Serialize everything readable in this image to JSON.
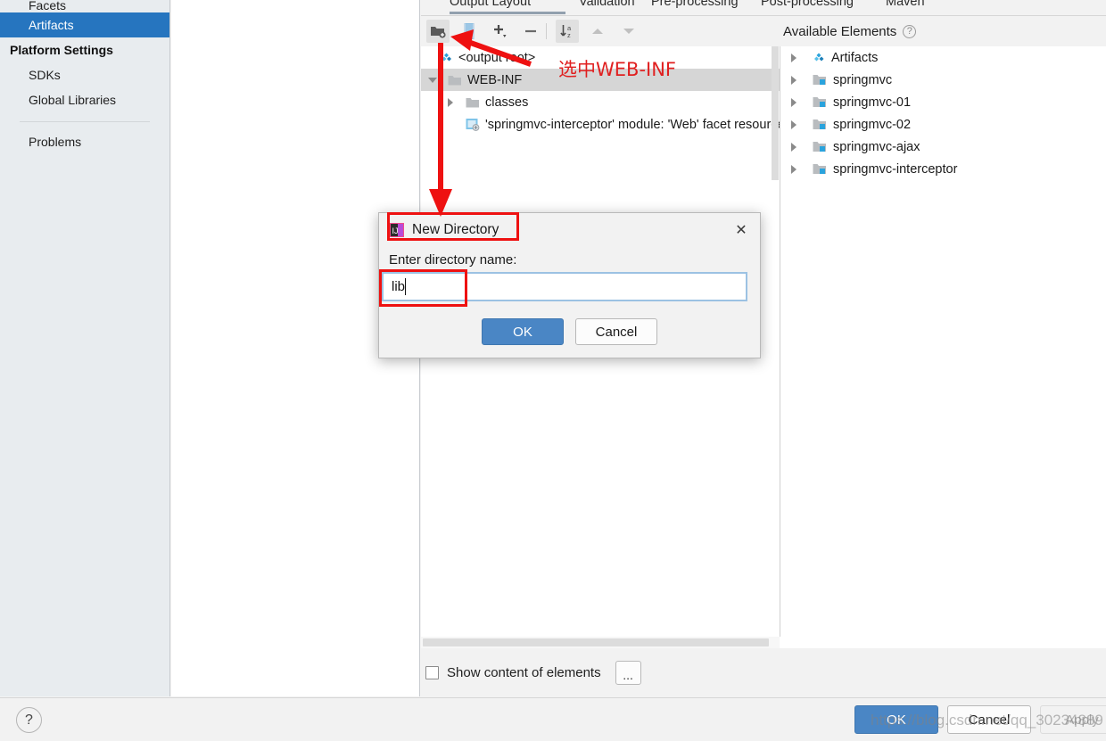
{
  "sidebar": {
    "items": [
      {
        "label": "Facets",
        "type": "item",
        "state": "clipped"
      },
      {
        "label": "Artifacts",
        "type": "item",
        "state": "selected"
      },
      {
        "label": "Platform Settings",
        "type": "group"
      },
      {
        "label": "SDKs",
        "type": "item"
      },
      {
        "label": "Global Libraries",
        "type": "item"
      },
      {
        "label": "Problems",
        "type": "item"
      }
    ]
  },
  "main": {
    "tabs": [
      {
        "label": "Output Layout",
        "selected": true
      },
      {
        "label": "Validation",
        "selected": false
      },
      {
        "label": "Pre-processing",
        "selected": false
      },
      {
        "label": "Post-processing",
        "selected": false
      },
      {
        "label": "Maven",
        "selected": false
      }
    ],
    "toolbar": {
      "buttons": [
        {
          "name": "create-directory-button",
          "icon": "folder-plus-icon",
          "active": true
        },
        {
          "name": "create-archive-button",
          "icon": "archive-icon",
          "active": false
        },
        {
          "name": "add-button",
          "icon": "plus-icon",
          "active": false
        },
        {
          "name": "remove-button",
          "icon": "minus-icon",
          "active": false
        },
        {
          "name": "sort-button",
          "icon": "sort-az-icon",
          "active": true
        },
        {
          "name": "move-up-button",
          "icon": "chevron-up-icon",
          "active": false
        },
        {
          "name": "move-down-button",
          "icon": "chevron-down-icon",
          "active": false
        }
      ]
    },
    "output_tree": [
      {
        "label": "<output root>",
        "icon": "artifact-diamond-icon",
        "indent": 0,
        "twisty": "open-diamond",
        "selected": false
      },
      {
        "label": "WEB-INF",
        "icon": "folder-icon",
        "indent": 1,
        "twisty": "open",
        "selected": true
      },
      {
        "label": "classes",
        "icon": "folder-icon",
        "indent": 2,
        "twisty": "closed",
        "selected": false
      },
      {
        "label": "'springmvc-interceptor' module: 'Web' facet resources",
        "icon": "facet-resource-icon",
        "indent": 2,
        "twisty": "none",
        "selected": false
      }
    ],
    "available_elements": {
      "title": "Available Elements",
      "help_glyph": "?",
      "items": [
        {
          "label": "Artifacts",
          "icon": "artifact-diamond-icon"
        },
        {
          "label": "springmvc",
          "icon": "module-folder-icon"
        },
        {
          "label": "springmvc-01",
          "icon": "module-folder-icon"
        },
        {
          "label": "springmvc-02",
          "icon": "module-folder-icon"
        },
        {
          "label": "springmvc-ajax",
          "icon": "module-folder-icon"
        },
        {
          "label": "springmvc-interceptor",
          "icon": "module-folder-icon"
        }
      ]
    },
    "bottom": {
      "checkbox_label": "Show content of elements",
      "checkbox_checked": false,
      "dots_button_label": "..."
    }
  },
  "footer": {
    "help_glyph": "?",
    "ok_label": "OK",
    "cancel_label": "Cancel",
    "apply_label": "Apply"
  },
  "dialog": {
    "title": "New Directory",
    "icon": "intellij-app-icon",
    "close_glyph": "✕",
    "field_label": "Enter directory name:",
    "field_value": "lib",
    "field_placeholder": "",
    "ok_label": "OK",
    "cancel_label": "Cancel"
  },
  "annotations": {
    "note_text": "选中WEB-INF",
    "note_color": "#e02020",
    "highlight_boxes": [
      "dialog-title",
      "dialog-input"
    ],
    "arrows": [
      "toolbar-create-directory",
      "down-to-dialog"
    ]
  },
  "watermark": {
    "text": "https://blog.csdn.net/qq_30234889"
  },
  "colors": {
    "accent_selection": "#2675bf",
    "tree_selection": "#d6d6d6",
    "primary_button": "#4a86c5",
    "annotation_red": "#ee1111",
    "panel_bg": "#f2f2f2",
    "sidebar_bg": "#e8ecef"
  }
}
